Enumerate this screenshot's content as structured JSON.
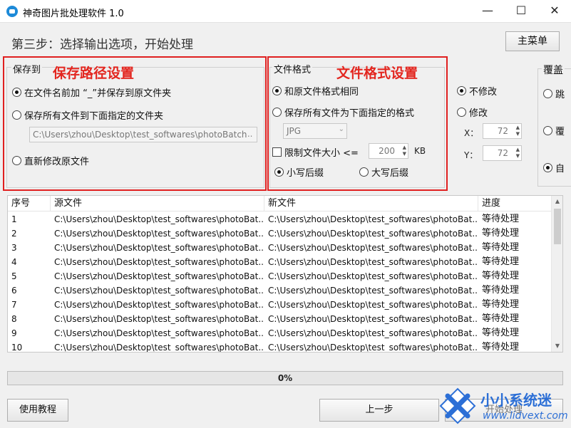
{
  "window": {
    "title": "神奇图片批处理软件 1.0",
    "minimize": "—",
    "maximize": "☐",
    "close": "✕"
  },
  "header": {
    "step_title": "第三步：选择输出选项，开始处理",
    "main_menu": "主菜单"
  },
  "save_to": {
    "group_label": "保存到",
    "annotation": "保存路径设置",
    "options": [
      "在文件名前加 “_”并保存到原文件夹",
      "保存所有文件到下面指定的文件夹",
      "直新修改原文件"
    ],
    "selected": 0,
    "folder_path": "C:\\Users\\zhou\\Desktop\\test_softwares\\photoBatch",
    "browse": "..."
  },
  "file_format": {
    "group_label": "文件格式",
    "annotation": "文件格式设置",
    "options": [
      "和原文件格式相同",
      "保存所有文件为下面指定的格式"
    ],
    "selected": 0,
    "format_value": "JPG",
    "limit_label": "限制文件大小 <=",
    "limit_value": "200",
    "limit_unit": "KB",
    "suffix_lower": "小写后缀",
    "suffix_upper": "大写后缀"
  },
  "resize": {
    "no_change": "不修改",
    "change": "修改",
    "x_label": "X：",
    "x_value": "72",
    "y_label": "Y：",
    "y_value": "72"
  },
  "overwrite": {
    "group_label": "覆盖",
    "options": [
      "跳",
      "覆",
      "自"
    ]
  },
  "table": {
    "columns": [
      "序号",
      "源文件",
      "新文件",
      "进度"
    ],
    "rows": [
      {
        "index": "1",
        "source": "C:\\Users\\zhou\\Desktop\\test_softwares\\photoBat...",
        "target": "C:\\Users\\zhou\\Desktop\\test_softwares\\photoBat...",
        "status": "等待处理"
      },
      {
        "index": "2",
        "source": "C:\\Users\\zhou\\Desktop\\test_softwares\\photoBat...",
        "target": "C:\\Users\\zhou\\Desktop\\test_softwares\\photoBat...",
        "status": "等待处理"
      },
      {
        "index": "3",
        "source": "C:\\Users\\zhou\\Desktop\\test_softwares\\photoBat...",
        "target": "C:\\Users\\zhou\\Desktop\\test_softwares\\photoBat...",
        "status": "等待处理"
      },
      {
        "index": "4",
        "source": "C:\\Users\\zhou\\Desktop\\test_softwares\\photoBat...",
        "target": "C:\\Users\\zhou\\Desktop\\test_softwares\\photoBat...",
        "status": "等待处理"
      },
      {
        "index": "5",
        "source": "C:\\Users\\zhou\\Desktop\\test_softwares\\photoBat...",
        "target": "C:\\Users\\zhou\\Desktop\\test_softwares\\photoBat...",
        "status": "等待处理"
      },
      {
        "index": "6",
        "source": "C:\\Users\\zhou\\Desktop\\test_softwares\\photoBat...",
        "target": "C:\\Users\\zhou\\Desktop\\test_softwares\\photoBat...",
        "status": "等待处理"
      },
      {
        "index": "7",
        "source": "C:\\Users\\zhou\\Desktop\\test_softwares\\photoBat...",
        "target": "C:\\Users\\zhou\\Desktop\\test_softwares\\photoBat...",
        "status": "等待处理"
      },
      {
        "index": "8",
        "source": "C:\\Users\\zhou\\Desktop\\test_softwares\\photoBat...",
        "target": "C:\\Users\\zhou\\Desktop\\test_softwares\\photoBat...",
        "status": "等待处理"
      },
      {
        "index": "9",
        "source": "C:\\Users\\zhou\\Desktop\\test_softwares\\photoBat...",
        "target": "C:\\Users\\zhou\\Desktop\\test_softwares\\photoBat...",
        "status": "等待处理"
      },
      {
        "index": "10",
        "source": "C:\\Users\\zhou\\Desktop\\test_softwares\\photoBat...",
        "target": "C:\\Users\\zhou\\Desktop\\test_softwares\\photoBat...",
        "status": "等待处理"
      }
    ]
  },
  "progress": {
    "value": 0,
    "label": "0%"
  },
  "footer": {
    "tutorial": "使用教程",
    "previous": "上一步",
    "start": "开始处理"
  },
  "watermark": {
    "site_name": "小小系统迷",
    "url": "www.lidvext.com"
  },
  "colors": {
    "annotation_red": "#e3261f",
    "watermark_blue": "#2c6fd6"
  }
}
